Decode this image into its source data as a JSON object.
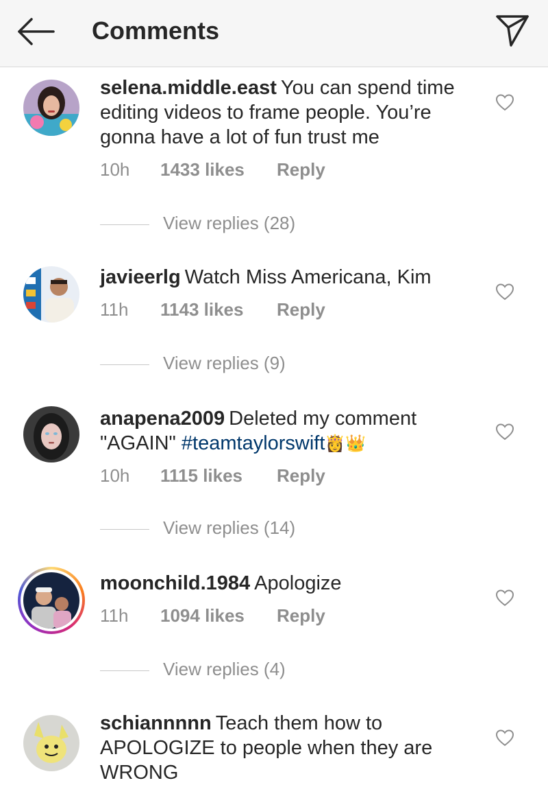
{
  "header": {
    "title": "Comments",
    "back_icon": "arrow-left-icon",
    "send_icon": "paper-plane-icon"
  },
  "comments": [
    {
      "username": "selena.middle.east",
      "text": "You can spend time editing videos to frame people. You’re gonna have a lot of fun trust me",
      "time": "10h",
      "likes": "1433 likes",
      "reply": "Reply",
      "view_replies": "View replies (28)"
    },
    {
      "username": "javieerlg",
      "text": "Watch Miss Americana, Kim",
      "time": "11h",
      "likes": "1143 likes",
      "reply": "Reply",
      "view_replies": "View replies (9)"
    },
    {
      "username": "anapena2009",
      "text": "Deleted my comment \"AGAIN\"",
      "hashtag": "#teamtaylorswift",
      "emoji": "👸👑",
      "time": "10h",
      "likes": "1115 likes",
      "reply": "Reply",
      "view_replies": "View replies (14)"
    },
    {
      "username": "moonchild.1984",
      "text": "Apologize",
      "time": "11h",
      "likes": "1094 likes",
      "reply": "Reply",
      "view_replies": "View replies (4)"
    },
    {
      "username": "schiannnnn",
      "text": "Teach them how to APOLOGIZE to people when they are WRONG"
    }
  ],
  "colors": {
    "header_bg": "#f6f6f6",
    "text": "#262626",
    "muted": "#8e8e8e",
    "hashtag": "#00376b"
  }
}
